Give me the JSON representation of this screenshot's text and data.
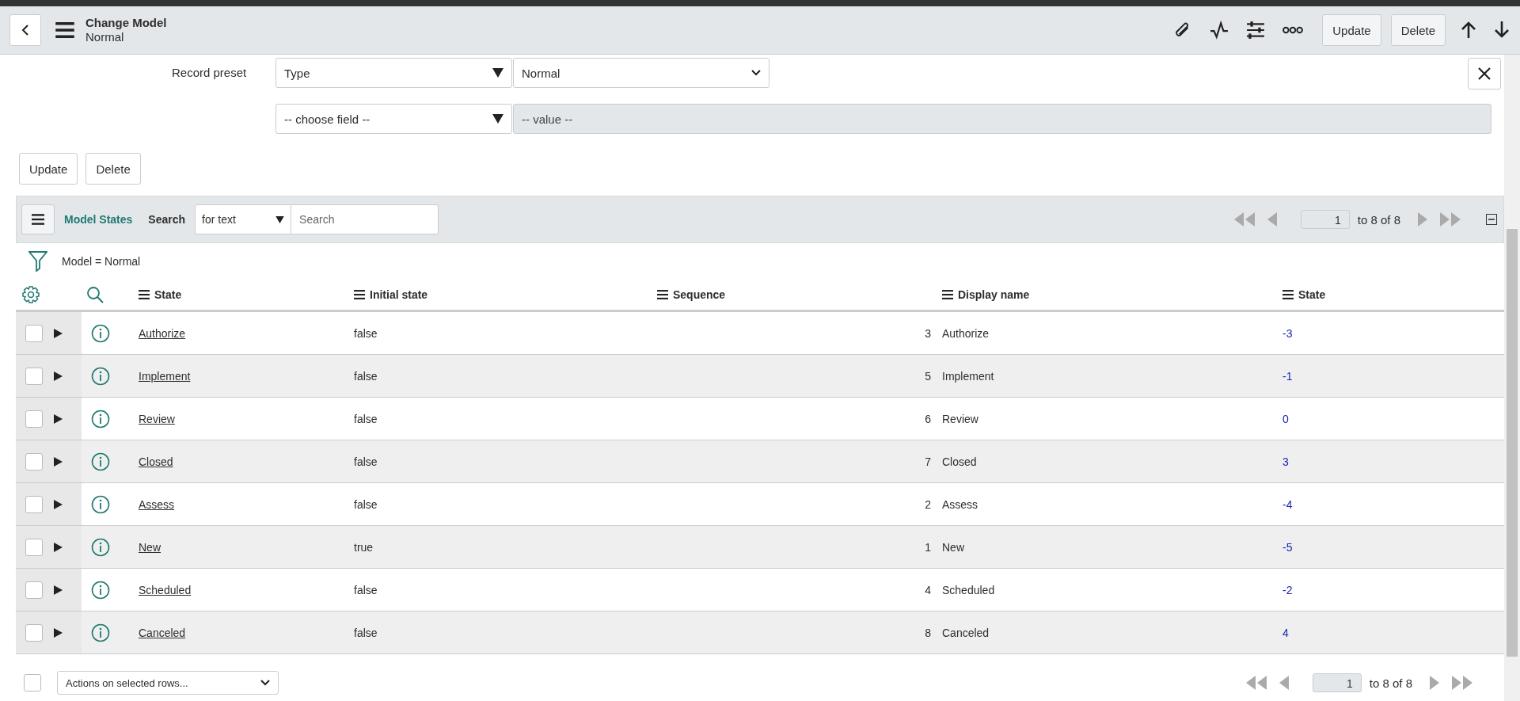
{
  "header": {
    "title": "Change Model",
    "subtitle": "Normal",
    "buttons": [
      "Update",
      "Delete"
    ]
  },
  "preset": {
    "label": "Record preset",
    "conditions": [
      {
        "field": "Type",
        "value": "Normal",
        "value_disabled": false
      },
      {
        "field": "-- choose field --",
        "value": "-- value --",
        "value_disabled": true
      }
    ]
  },
  "form_buttons": [
    "Update",
    "Delete"
  ],
  "list": {
    "title": "Model States",
    "search_label": "Search",
    "search_scope": "for text",
    "search_placeholder": "Search",
    "page": "1",
    "range": "to 8 of 8",
    "filter": "Model = Normal",
    "columns": [
      "State",
      "Initial state",
      "Sequence",
      "Display name",
      "State"
    ],
    "rows": [
      {
        "checked": false,
        "cells": [
          "Authorize",
          "false",
          "3",
          "Authorize",
          "-3"
        ]
      },
      {
        "checked": false,
        "cells": [
          "Implement",
          "false",
          "5",
          "Implement",
          "-1"
        ]
      },
      {
        "checked": false,
        "cells": [
          "Review",
          "false",
          "6",
          "Review",
          "0"
        ]
      },
      {
        "checked": false,
        "cells": [
          "Closed",
          "false",
          "7",
          "Closed",
          "3"
        ]
      },
      {
        "checked": false,
        "cells": [
          "Assess",
          "false",
          "2",
          "Assess",
          "-4"
        ]
      },
      {
        "checked": false,
        "cells": [
          "New",
          "true",
          "1",
          "New",
          "-5"
        ]
      },
      {
        "checked": false,
        "cells": [
          "Scheduled",
          "false",
          "4",
          "Scheduled",
          "-2"
        ]
      },
      {
        "checked": false,
        "cells": [
          "Canceled",
          "false",
          "8",
          "Canceled",
          "4"
        ]
      }
    ],
    "footer": {
      "checked": false,
      "actions": "Actions on selected rows...",
      "page": "1",
      "range": "to 8 of 8"
    }
  }
}
